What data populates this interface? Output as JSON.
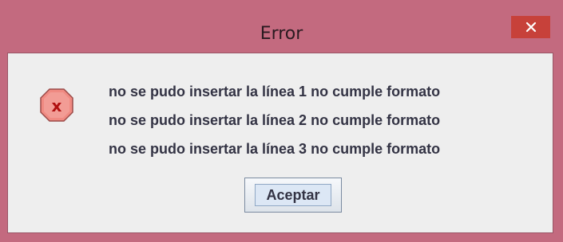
{
  "dialog": {
    "title": "Error",
    "close_icon": "close-icon",
    "error_icon": "error-icon",
    "messages": [
      "no se pudo insertar la línea 1 no cumple formato",
      "no se pudo insertar la línea 2 no cumple formato",
      "no se pudo insertar la línea 3 no cumple formato"
    ],
    "ok_label": "Aceptar"
  },
  "colors": {
    "titlebar": "#c36a7f",
    "close_button": "#c7413a",
    "content_background": "#eeeeee",
    "error_icon_fill": "#f08a82",
    "error_icon_x": "#b01010"
  }
}
